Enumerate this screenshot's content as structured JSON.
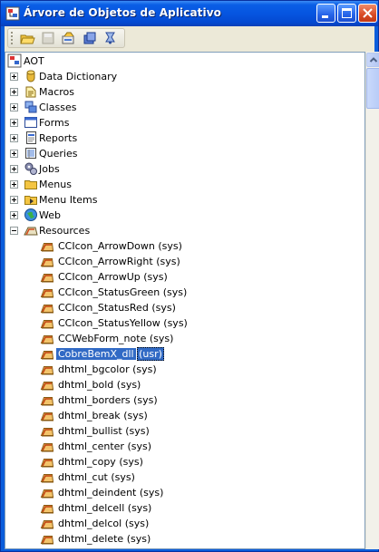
{
  "window": {
    "title": "Árvore de Objetos de Aplicativo"
  },
  "toolbar": {
    "icons": [
      "open-icon",
      "save-icon",
      "properties-icon",
      "compile-icon",
      "find-icon"
    ]
  },
  "tree": {
    "root": "AOT",
    "nodes": [
      {
        "label": "Data Dictionary",
        "icon": "database-icon",
        "expanded": false
      },
      {
        "label": "Macros",
        "icon": "macro-icon",
        "expanded": false
      },
      {
        "label": "Classes",
        "icon": "class-icon",
        "expanded": false
      },
      {
        "label": "Forms",
        "icon": "form-icon",
        "expanded": false
      },
      {
        "label": "Reports",
        "icon": "report-icon",
        "expanded": false
      },
      {
        "label": "Queries",
        "icon": "query-icon",
        "expanded": false
      },
      {
        "label": "Jobs",
        "icon": "job-icon",
        "expanded": false
      },
      {
        "label": "Menus",
        "icon": "menu-folder-icon",
        "expanded": false
      },
      {
        "label": "Menu Items",
        "icon": "menu-items-icon",
        "expanded": false
      },
      {
        "label": "Web",
        "icon": "globe-icon",
        "expanded": false
      },
      {
        "label": "Resources",
        "icon": "resources-icon",
        "expanded": true
      }
    ],
    "resources": [
      {
        "name": "CCIcon_ArrowDown",
        "layer": "(sys)"
      },
      {
        "name": "CCIcon_ArrowRight",
        "layer": "(sys)"
      },
      {
        "name": "CCIcon_ArrowUp",
        "layer": "(sys)"
      },
      {
        "name": "CCIcon_StatusGreen",
        "layer": "(sys)"
      },
      {
        "name": "CCIcon_StatusRed",
        "layer": "(sys)"
      },
      {
        "name": "CCIcon_StatusYellow",
        "layer": "(sys)"
      },
      {
        "name": "CCWebForm_note",
        "layer": "(sys)"
      },
      {
        "name": "CobreBemX_dll",
        "layer": "(usr)",
        "selected": true
      },
      {
        "name": "dhtml_bgcolor",
        "layer": "(sys)"
      },
      {
        "name": "dhtml_bold",
        "layer": "(sys)"
      },
      {
        "name": "dhtml_borders",
        "layer": "(sys)"
      },
      {
        "name": "dhtml_break",
        "layer": "(sys)"
      },
      {
        "name": "dhtml_bullist",
        "layer": "(sys)"
      },
      {
        "name": "dhtml_center",
        "layer": "(sys)"
      },
      {
        "name": "dhtml_copy",
        "layer": "(sys)"
      },
      {
        "name": "dhtml_cut",
        "layer": "(sys)"
      },
      {
        "name": "dhtml_deindent",
        "layer": "(sys)"
      },
      {
        "name": "dhtml_delcell",
        "layer": "(sys)"
      },
      {
        "name": "dhtml_delcol",
        "layer": "(sys)"
      },
      {
        "name": "dhtml_delete",
        "layer": "(sys)"
      }
    ]
  },
  "colors": {
    "titlebar": "#0655e0",
    "selection": "#316ac5",
    "window_bg": "#ece9d8"
  }
}
